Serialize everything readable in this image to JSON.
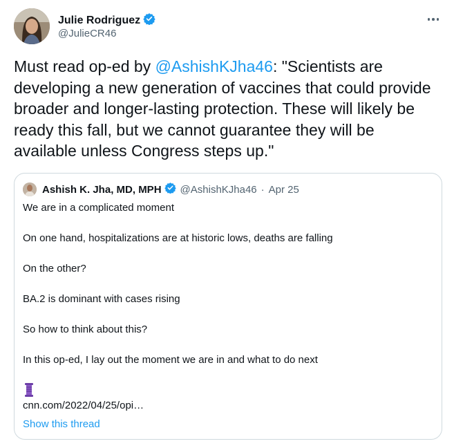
{
  "author": {
    "name": "Julie Rodriguez",
    "handle": "@JulieCR46"
  },
  "tweet": {
    "prefix": "Must read op-ed by ",
    "mention": "@AshishKJha46",
    "body": ": \"Scientists are developing a new generation of vaccines that could provide broader and longer-lasting protection. These will likely be ready this fall, but we cannot guarantee they will be available unless Congress steps up.\""
  },
  "quote": {
    "name": "Ashish K. Jha, MD, MPH",
    "handle": "@AshishKJha46",
    "separator": "·",
    "date": "Apr 25",
    "lines": [
      "We are in a complicated moment",
      "On one hand, hospitalizations are at historic lows, deaths are falling",
      "On the other?",
      "BA.2 is dominant with cases rising",
      "So how to think about this?",
      "In this op-ed, I lay out the moment we are in and what to do next",
      "cnn.com/2022/04/25/opi…"
    ],
    "show_thread": "Show this thread"
  },
  "colors": {
    "accent": "#1d9bf0",
    "text": "#0f1419",
    "secondary": "#536471",
    "border": "#cfd9de"
  }
}
